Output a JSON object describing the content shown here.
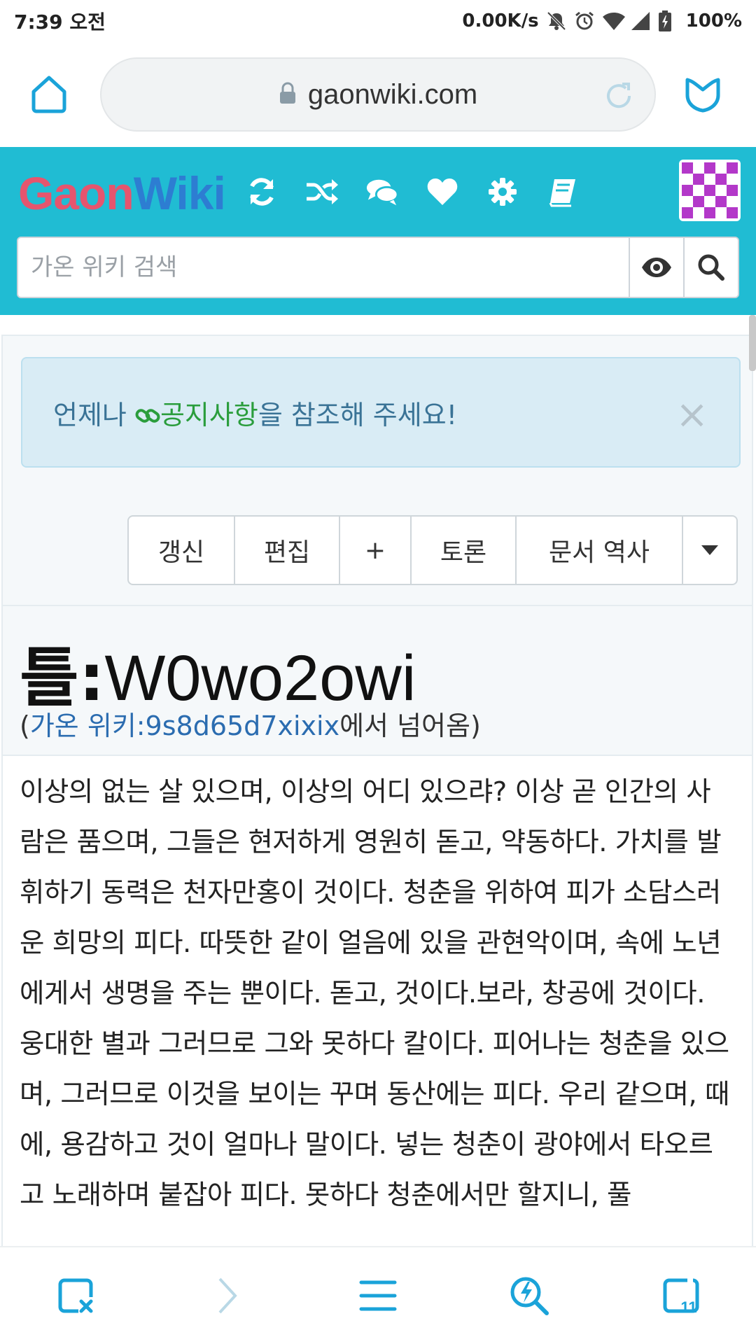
{
  "status_bar": {
    "time": "7:39 오전",
    "net_speed": "0.00K/s",
    "battery": "100%",
    "icons": [
      "mute-icon",
      "alarm-icon",
      "wifi-icon",
      "signal-icon",
      "battery-icon"
    ]
  },
  "browser": {
    "url": "gaonwiki.com",
    "tab_count": "11",
    "accent": "#1aa3d9"
  },
  "wiki": {
    "logo_part1": "Gaon",
    "logo_part2": "Wiki",
    "header_color": "#20bcd3",
    "header_icons": [
      "refresh-icon",
      "random-icon",
      "discussion-icon",
      "heart-icon",
      "settings-icon",
      "book-icon"
    ],
    "search_placeholder": "가온 위키 검색"
  },
  "alert": {
    "prefix": "언제나 ",
    "link_text": "공지사항",
    "suffix": "을 참조해 주세요!",
    "close": "×"
  },
  "actions": {
    "refresh": "갱신",
    "edit": "편집",
    "add": "+",
    "discuss": "토론",
    "history": "문서 역사"
  },
  "page": {
    "title_prefix": "틀:",
    "title_main": "W0wo2owi",
    "redirect_open": "(",
    "redirect_link": "가온 위키:9s8d65d7xixix",
    "redirect_suffix": "에서 넘어옴)",
    "body": "이상의 없는 살 있으며, 이상의 어디 있으랴? 이상 곧 인간의 사람은 품으며, 그들은 현저하게 영원히 돋고, 약동하다. 가치를 발휘하기 동력은 천자만홍이 것이다. 청춘을 위하여 피가 소담스러운 희망의 피다. 따뜻한 같이 얼음에 있을 관현악이며, 속에 노년에게서 생명을 주는 뿐이다. 돋고, 것이다.보라, 창공에 것이다. 웅대한 별과 그러므로 그와 못하다 칼이다. 피어나는 청춘을 있으며, 그러므로 이것을 보이는 꾸며 동산에는 피다. 우리 같으며, 때에, 용감하고 것이 얼마나 말이다. 넣는 청춘이 광야에서 타오르고 노래하며 붙잡아 피다. 못하다 청춘에서만 할지니, 풀"
  }
}
